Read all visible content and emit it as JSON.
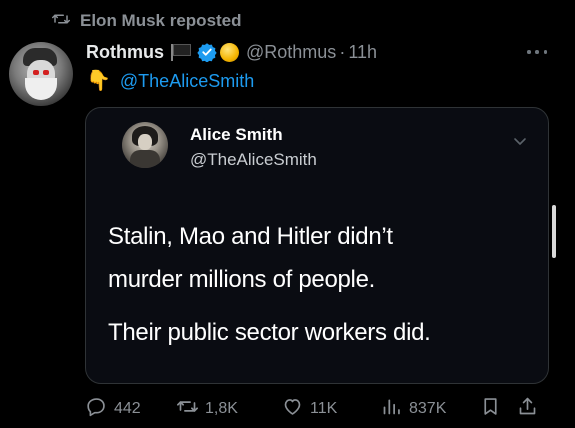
{
  "repost_banner": {
    "text": "Elon Musk reposted"
  },
  "post": {
    "author_name": "Rothmus",
    "handle": "@Rothmus",
    "separator": "·",
    "time": "11h",
    "mention_emoji": "👇",
    "mention": "@TheAliceSmith"
  },
  "quote": {
    "name": "Alice Smith",
    "handle": "@TheAliceSmith",
    "lines": [
      "Stalin, Mao and Hitler didn’t",
      "murder millions of people.",
      "Their public sector workers did."
    ]
  },
  "actions": {
    "replies": "442",
    "reposts": "1,8K",
    "likes": "11K",
    "views": "837K"
  },
  "colors": {
    "accent": "#1d9bf0",
    "muted": "#8b9096",
    "background": "#000000"
  }
}
